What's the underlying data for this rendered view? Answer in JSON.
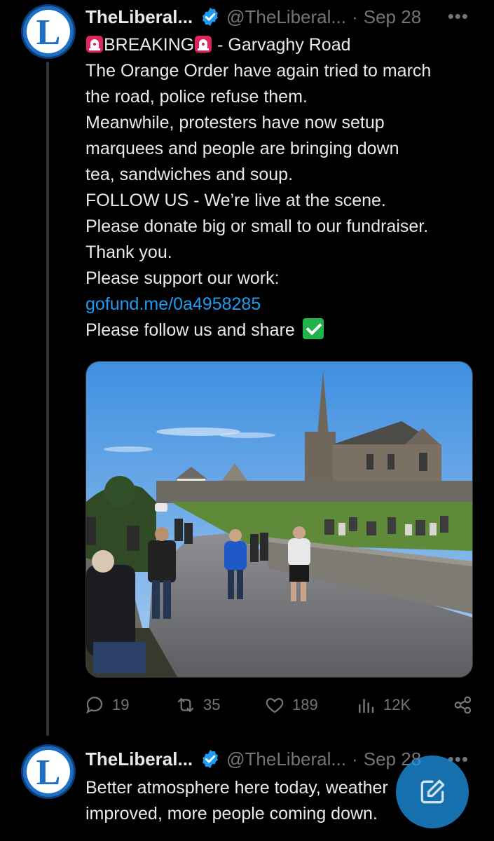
{
  "tweets": [
    {
      "avatar_letter": "L",
      "display_name": "TheLiberal...",
      "handle": "@TheLiberal...",
      "separator": "·",
      "date": "Sep 28",
      "more": "•••",
      "lines": {
        "breaking": "BREAKING",
        "breaking_rest": " - Garvaghy Road",
        "l2": "The Orange Order have again tried to march",
        "l3": "the road, police refuse them.",
        "l4": "Meanwhile, protesters have now setup",
        "l5": "marquees and people are bringing down",
        "l6": "tea, sandwiches and soup.",
        "l7": "FOLLOW US - We’re live at the scene.",
        "l8": "Please donate big or small to our fundraiser.",
        "l9": "Thank you.",
        "l10": "Please support our work:",
        "link": "gofund.me/0a4958285",
        "l12": "Please follow us and share"
      },
      "stats": {
        "replies": "19",
        "reposts": "35",
        "likes": "189",
        "views": "12K"
      },
      "icons": [
        "reply-icon",
        "repost-icon",
        "like-icon",
        "views-icon",
        "share-icon"
      ]
    },
    {
      "avatar_letter": "L",
      "display_name": "TheLiberal...",
      "handle": "@TheLiberal...",
      "separator": "·",
      "date": "Sep 28",
      "more": "•••",
      "lines": {
        "l1": "Better atmosphere here today, weather",
        "l2": "improved, more people coming down."
      }
    }
  ],
  "colors": {
    "background": "#000000",
    "text": "#e7e9ea",
    "secondary": "#71767b",
    "link": "#1d9bf0",
    "verified": "#1d9bf0"
  }
}
